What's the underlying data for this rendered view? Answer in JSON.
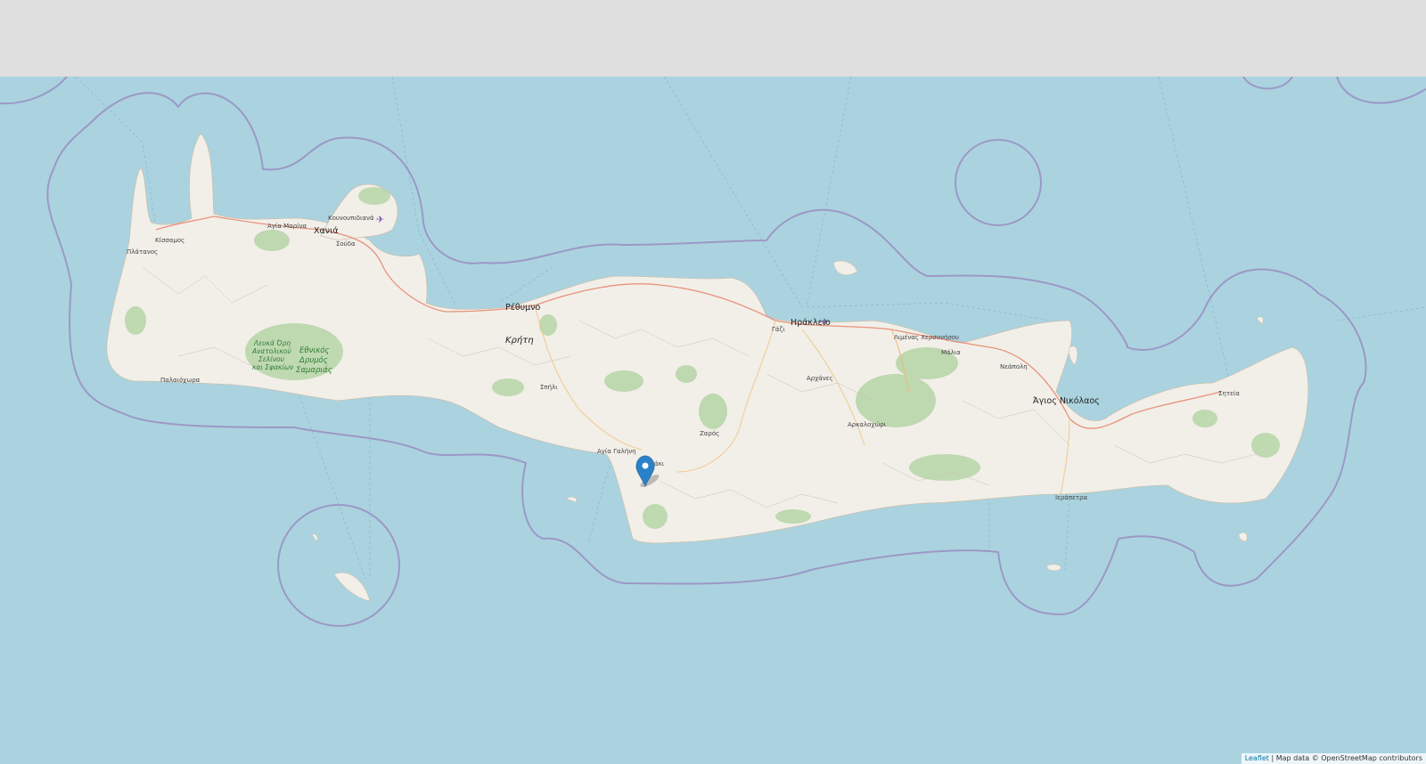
{
  "map": {
    "labels": {
      "chania": "Χανιά",
      "kissamos": "Κίσσαμος",
      "platanos": "Πλάτανος",
      "agia_marina": "Αγία Μαρίνα",
      "kounoupidiana": "Κουνουπιδιανά",
      "souda": "Σούδα",
      "paleochora": "Παλαιόχωρα",
      "park_line1": "Λευκά Όρη",
      "park_line2": "Ανατολικού",
      "park_line3": "Σελίνου",
      "park_line4": "και Σφακίων",
      "park2_line1": "Εθνικός",
      "park2_line2": "Δρυμός",
      "park2_line3": "Σαμαριάς",
      "rethymno": "Ρέθυμνο",
      "kriti": "Κρήτη",
      "spili": "Σπήλι",
      "agia_galini": "Αγία Γαλήνη",
      "tympaki": "Τυμπάκι",
      "zaros": "Ζαρός",
      "gazi": "Γάζι",
      "heraklion": "Ηράκλειο",
      "archanes": "Αρχάνες",
      "arkalochori": "Αρκαλοχώρι",
      "limenas": "Λιμένας Χερσονήσου",
      "malia": "Μάλια",
      "neapoli": "Νεάπολη",
      "agios_nikolaos": "Άγιος Νικόλαος",
      "ierapetra": "Ιεράπετρα",
      "siteia": "Σητεία"
    },
    "marker": {
      "icon": "map-marker-icon",
      "color": "#2a81cb"
    },
    "colors": {
      "sea": "#aad3df",
      "land": "#f2efe9",
      "boundary": "#9e9ec4",
      "road": "#e8927c",
      "forest": "#add19e"
    }
  },
  "attribution": {
    "leaflet": "Leaflet",
    "separator": " | ",
    "text": "Map data © OpenStreetMap contributors"
  }
}
